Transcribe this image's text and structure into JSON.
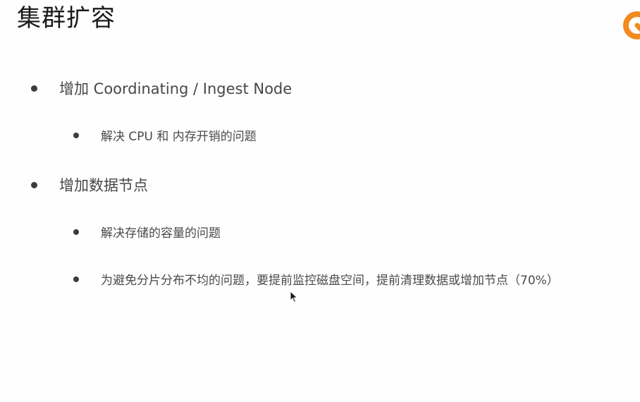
{
  "slide": {
    "title": "集群扩容",
    "bullets": [
      {
        "text": "增加 Coordinating / Ingest Node",
        "children": [
          {
            "text": "解决 CPU 和 内存开销的问题"
          }
        ]
      },
      {
        "text": "增加数据节点",
        "children": [
          {
            "text": "解决存储的容量的问题"
          },
          {
            "text": "为避免分片分布不均的问题，要提前监控磁盘空间，提前清理数据或增加节点（70%）"
          }
        ]
      }
    ]
  },
  "icons": {
    "logo": "brand-logo-icon",
    "cursor": "mouse-pointer-icon"
  },
  "colors": {
    "title": "#1a1a1a",
    "body_text": "#474747",
    "bullet_dot": "#3c3c3c",
    "logo_accent": "#f28a1e"
  }
}
